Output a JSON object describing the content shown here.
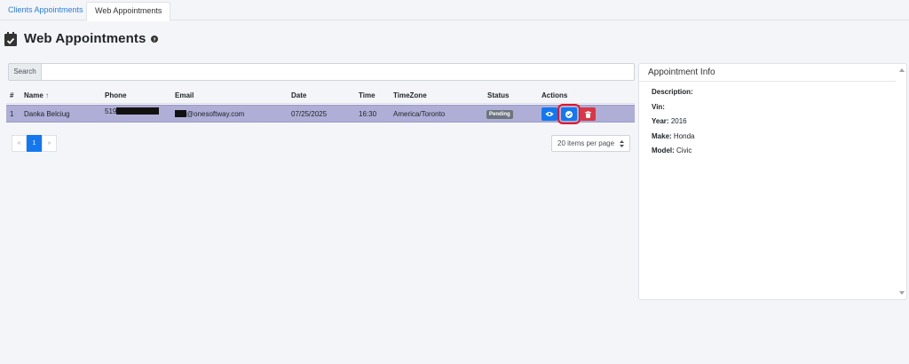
{
  "tabs": [
    {
      "label": "Clients Appointments",
      "active": false
    },
    {
      "label": "Web Appointments",
      "active": true
    }
  ],
  "page": {
    "title": "Web Appointments",
    "title_icon": "calendar-check-icon",
    "help_icon": "question-circle-icon"
  },
  "search": {
    "label": "Search",
    "value": "",
    "placeholder": ""
  },
  "table": {
    "columns": [
      "#",
      "Name",
      "Phone",
      "Email",
      "Date",
      "Time",
      "TimeZone",
      "Status",
      "Actions"
    ],
    "sort_indicator": "↑",
    "rows": [
      {
        "index": "1",
        "name": "Danka Belciug",
        "phone_visible": "519",
        "email_visible": "@onesoftway.com",
        "date": "07/25/2025",
        "time": "16:30",
        "timezone": "America/Toronto",
        "status": "Pending"
      }
    ]
  },
  "pagination": {
    "prev": "«",
    "current": "1",
    "next": "»",
    "per_page": "20 items per page"
  },
  "appointment_info": {
    "title": "Appointment Info",
    "fields": [
      {
        "label": "Description:",
        "value": ""
      },
      {
        "label": "Vin:",
        "value": ""
      },
      {
        "label": "Year:",
        "value": "2016"
      },
      {
        "label": "Make:",
        "value": "Honda"
      },
      {
        "label": "Model:",
        "value": "Civic"
      }
    ]
  },
  "colors": {
    "accent": "#1378f0",
    "danger": "#dc3545",
    "selected_row": "#aeaed6",
    "highlight_outline": "#e8112b",
    "badge": "#6c757d"
  }
}
